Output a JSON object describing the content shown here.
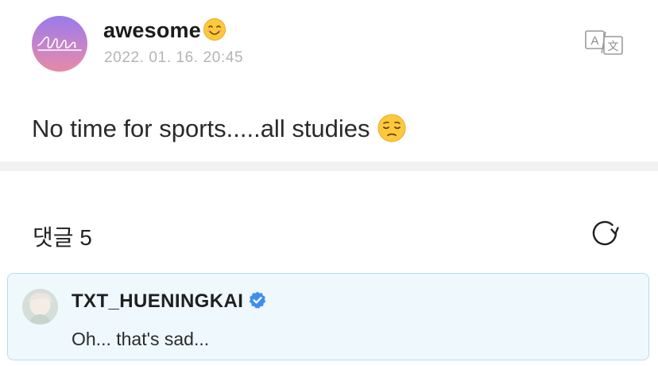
{
  "post": {
    "author": "awesome",
    "author_emoji": "smiling-face-emoji",
    "date": "2022. 01. 16. 20:45",
    "body": "No time for sports.....all studies",
    "body_emoji": "pensive-face-emoji",
    "translate_icon": "translate-icon"
  },
  "comments_section": {
    "title": "댓글 5",
    "refresh_icon": "refresh-icon"
  },
  "comment": {
    "author": "TXT_HUENINGKAI",
    "verified_icon": "verified-badge-icon",
    "text": "Oh... that's sad..."
  },
  "colors": {
    "date_gray": "#b4b4b4",
    "comment_bg": "#eff8fd",
    "comment_border": "#b6dcf0",
    "verified_blue": "#3d8ef0",
    "avatar_gradient_top": "#9a7bea",
    "avatar_gradient_bottom": "#e889a6"
  }
}
